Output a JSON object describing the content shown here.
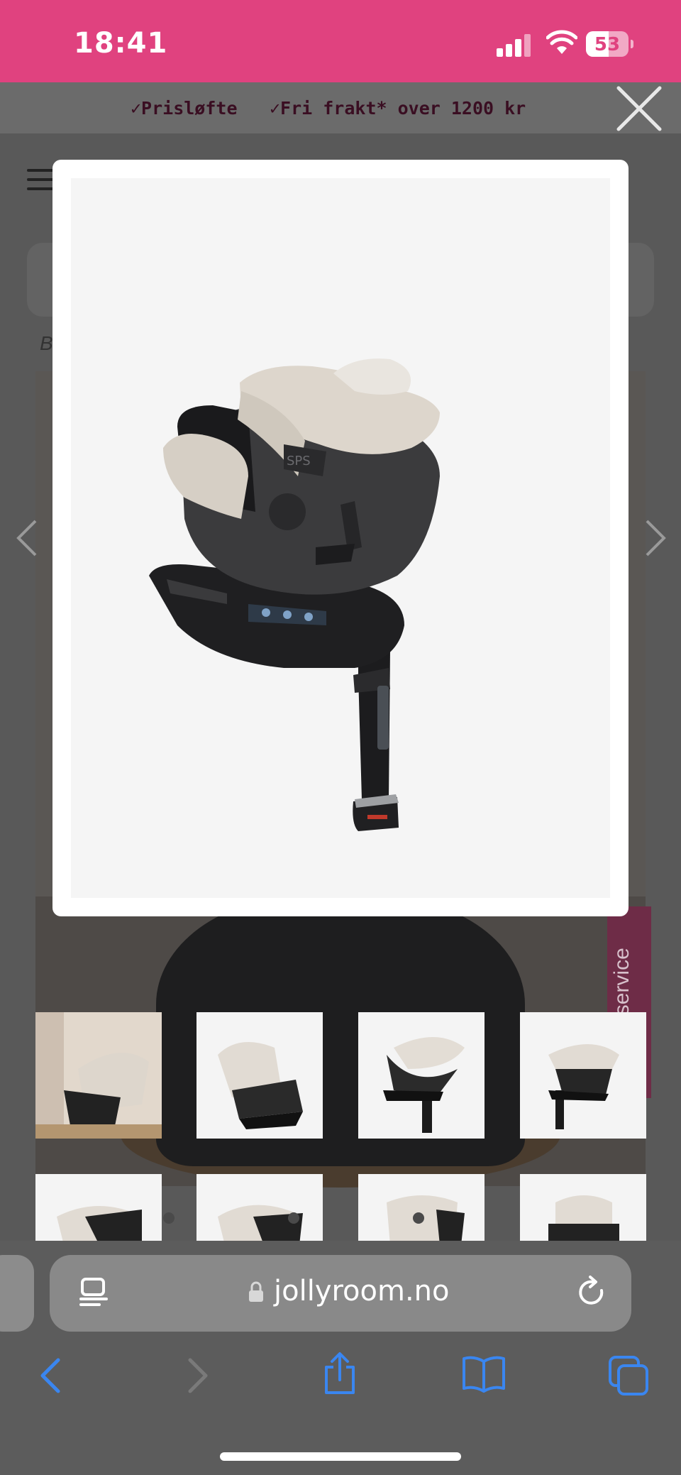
{
  "status_bar": {
    "time": "18:41",
    "battery_level": "53",
    "battery_fraction": 0.53,
    "background_color": "#e0427f"
  },
  "promo_bar": {
    "items": [
      "✓Prisløfte",
      "✓Fri frakt* over 1200 kr"
    ]
  },
  "page": {
    "breadcrumb_initial": "B",
    "kundeservice_label": "Kundeservice"
  },
  "modal": {
    "image_alt_icon": "car-seat-image",
    "close_icon": "close-icon"
  },
  "thumbnails": [
    {
      "name": "thumbnail-1"
    },
    {
      "name": "thumbnail-2"
    },
    {
      "name": "thumbnail-3"
    },
    {
      "name": "thumbnail-4"
    },
    {
      "name": "thumbnail-5"
    },
    {
      "name": "thumbnail-6"
    },
    {
      "name": "thumbnail-7"
    },
    {
      "name": "thumbnail-8"
    }
  ],
  "browser": {
    "url": "jollyroom.no",
    "icons": [
      "reader-icon",
      "lock-icon",
      "reload-icon",
      "back-icon",
      "forward-icon",
      "share-icon",
      "bookmarks-icon",
      "tabs-icon"
    ],
    "accent_color": "#3a86f0"
  }
}
